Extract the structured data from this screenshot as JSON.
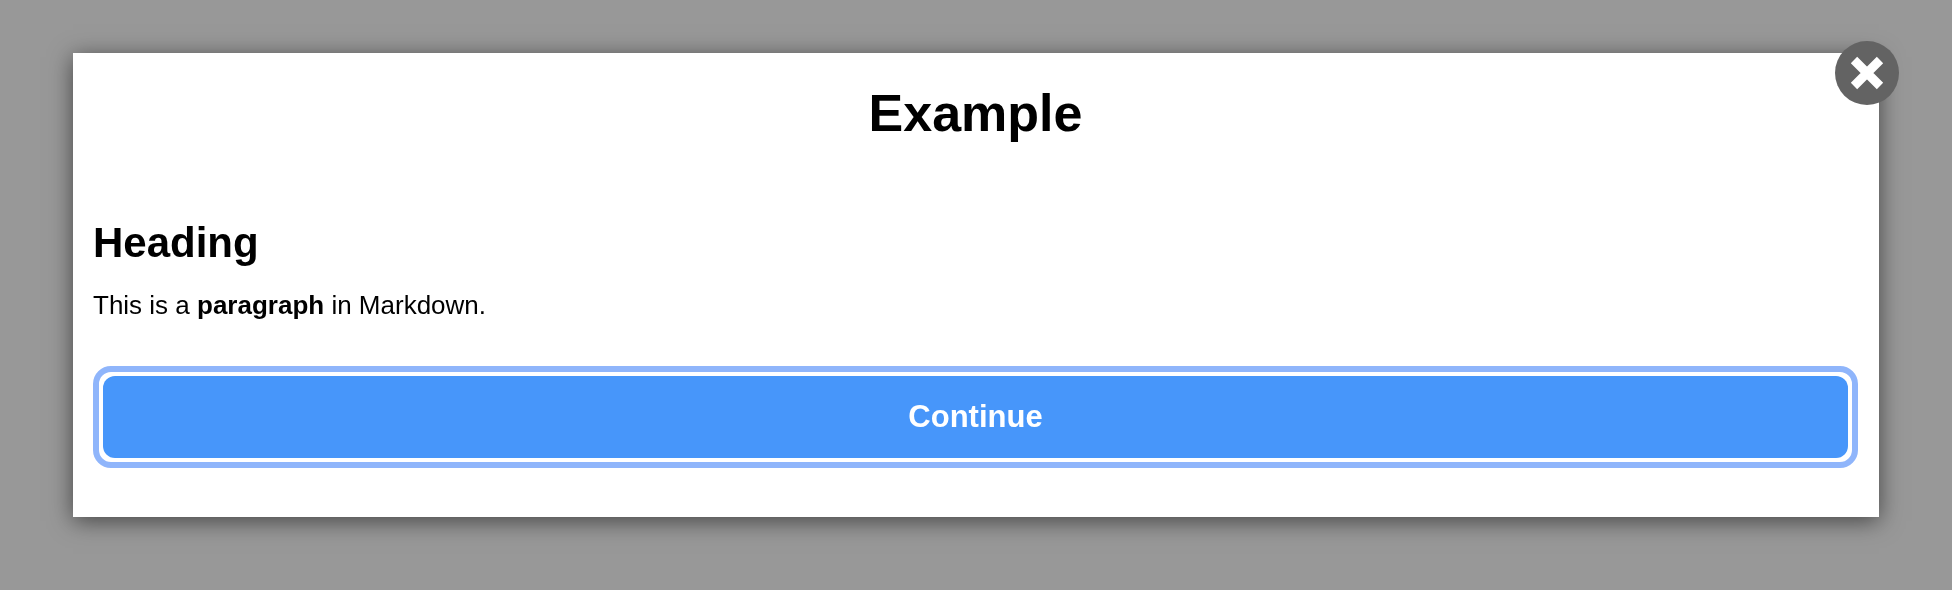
{
  "dialog": {
    "title": "Example",
    "heading": "Heading",
    "paragraph": "This is a **paragraph** in Markdown.",
    "button": {
      "label": "Continue"
    }
  }
}
